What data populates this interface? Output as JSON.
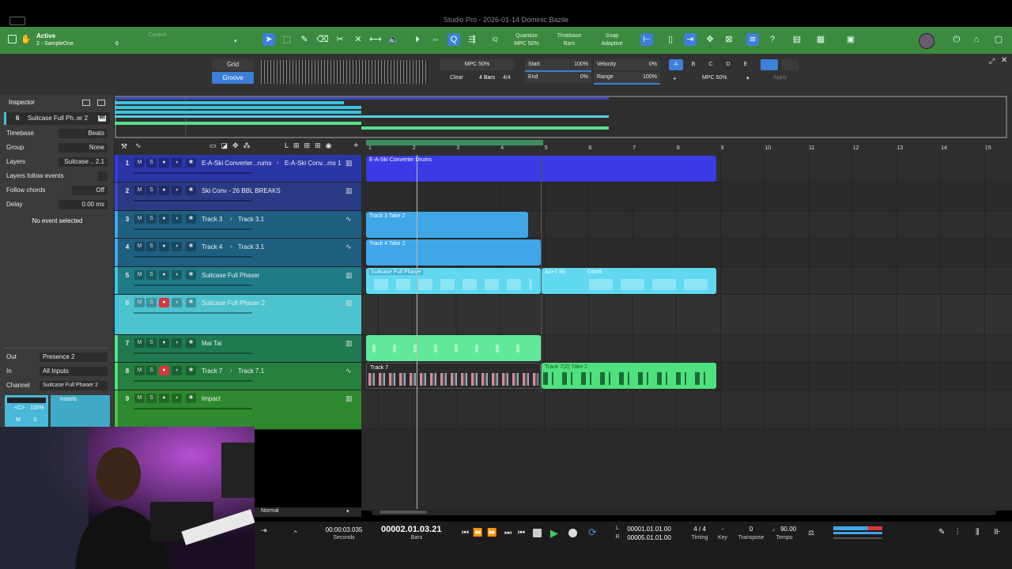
{
  "window": {
    "title": "Studio Pro - 2026-01-14 Dominic Bazile"
  },
  "toolbar": {
    "status_label": "Active",
    "song_label": "2 - SampleOne",
    "song_number": "6",
    "control_label": "Control",
    "quantize_label": "Quantize",
    "quantize_value": "MPC 50%",
    "timebase_label": "Timebase",
    "timebase_value": "Bars",
    "snap_label": "Snap",
    "snap_value": "Adaptive",
    "iq_label": "IQ"
  },
  "editbar": {
    "grid_label": "Grid",
    "groove_label": "Groove",
    "mpc_label": "MPC 50%",
    "clear_label": "Clear",
    "bars_label": "4 Bars",
    "sig_label": "4/4",
    "start_label": "Start",
    "start_value": "100%",
    "end_label": "End",
    "end_value": "0%",
    "velocity_label": "Velocity",
    "velocity_value": "0%",
    "range_label": "Range",
    "range_value": "100%",
    "variations": [
      "A",
      "B",
      "C",
      "D",
      "E"
    ],
    "plus_label": "+",
    "preset_value": "MPC 50%",
    "apply_label": "Apply"
  },
  "inspector": {
    "title": "Inspector",
    "track_number": "6",
    "track_name": "Suitcase Full Ph..er 2",
    "rows": [
      {
        "label": "Timebase",
        "value": "Beats"
      },
      {
        "label": "Group",
        "value": "None"
      },
      {
        "label": "Layers",
        "value": "Suitcase .. 2.1"
      },
      {
        "label": "Layers follow events",
        "value": ""
      },
      {
        "label": "Follow chords",
        "value": "Off"
      },
      {
        "label": "Delay",
        "value": "0.00 ms"
      }
    ],
    "no_event": "No event selected",
    "out_label": "Out",
    "out_value": "Presence 2",
    "in_label": "In",
    "in_value": "All Inputs",
    "channel_label": "Channel",
    "channel_value": "Suitcase Full Phaser 2",
    "inserts_label": "Inserts",
    "pan_label": "<C>",
    "vol_label": "100%",
    "m_label": "M",
    "s_label": "S"
  },
  "ruler": {
    "bars": [
      "1",
      "2",
      "3",
      "4",
      "5",
      "6",
      "7",
      "8",
      "9",
      "10",
      "11",
      "12",
      "13",
      "14",
      "15"
    ]
  },
  "track_buttons": {
    "m": "M",
    "s": "S"
  },
  "tracks": [
    {
      "num": "1",
      "name": "E-A-Ski Converter...rums",
      "lane": "E-A-Ski Conv...ms 1"
    },
    {
      "num": "2",
      "name": "Ski Conv - 26 BBL BREAKS",
      "lane": ""
    },
    {
      "num": "3",
      "name": "Track 3",
      "lane": "Track 3.1"
    },
    {
      "num": "4",
      "name": "Track 4",
      "lane": "Track 3.1"
    },
    {
      "num": "5",
      "name": "Suitcase Full Phaser",
      "lane": ""
    },
    {
      "num": "6",
      "name": "Suitcase Full Phaser 2",
      "lane": ""
    },
    {
      "num": "7",
      "name": "Mai Tai",
      "lane": ""
    },
    {
      "num": "8",
      "name": "Track 7",
      "lane": "Track 7.1"
    },
    {
      "num": "9",
      "name": "Impact",
      "lane": ""
    }
  ],
  "clips": {
    "c1": "E-A-Ski Converter Drums",
    "c3": "Track 3 Take 2",
    "c4": "Track 4 Take 2",
    "c5a": "Suitcase Full Phaser",
    "c5b": "A♯+7 #9",
    "c5c": "D♯m9",
    "c8a": "Track 7",
    "c8b": "Track 7(2) Take 2"
  },
  "footer": {
    "normal_label": "Normal"
  },
  "transport": {
    "seconds_value": "00:00:03.035",
    "seconds_label": "Seconds",
    "bars_value": "00002.01.03.21",
    "bars_label": "Bars",
    "l_label": "L",
    "r_label": "R",
    "loop_start": "00001.01.01.00",
    "loop_end": "00005.01.01.00",
    "timing_value": "4 / 4",
    "timing_label": "Timing",
    "key_value": "-",
    "key_label": "Key",
    "transpose_value": "0",
    "transpose_label": "Transpose",
    "tempo_value": "♩ 90.00",
    "tempo_label": "Tempo"
  },
  "colors": {
    "toolbar": "#3b8a3f",
    "accent": "#3d7fd9",
    "track_blue": "#3a49c8",
    "track_cyan": "#3fc2e0",
    "track_green": "#55e08c",
    "record": "#d9353b"
  }
}
